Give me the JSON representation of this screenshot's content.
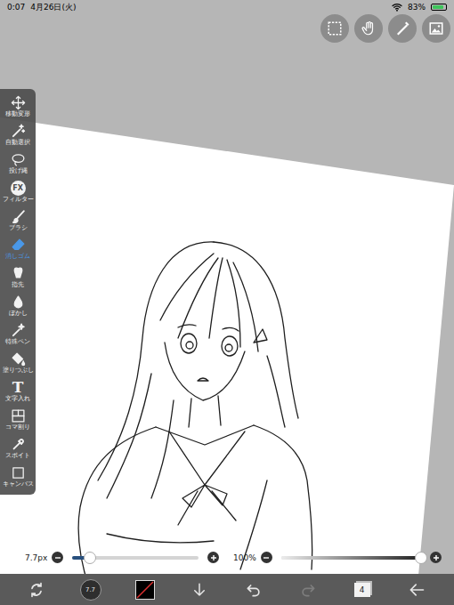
{
  "status_bar": {
    "time": "0:07",
    "date": "4月26日(火)",
    "battery": "83%",
    "battery_level": 0.83,
    "charging": true
  },
  "tools": [
    {
      "label": "移動変形",
      "selected": false
    },
    {
      "label": "自動選択",
      "selected": false
    },
    {
      "label": "投げ縄",
      "selected": false
    },
    {
      "label": "フィルター",
      "selected": false,
      "glyph": "FX"
    },
    {
      "label": "ブラシ",
      "selected": false
    },
    {
      "label": "消しゴム",
      "selected": true
    },
    {
      "label": "指先",
      "selected": false
    },
    {
      "label": "ぼかし",
      "selected": false
    },
    {
      "label": "特殊ペン",
      "selected": false
    },
    {
      "label": "塗りつぶし",
      "selected": false
    },
    {
      "label": "文字入れ",
      "selected": false,
      "glyph": "T"
    },
    {
      "label": "コマ割り",
      "selected": false
    },
    {
      "label": "スポイト",
      "selected": false
    },
    {
      "label": "キャンバス",
      "selected": false
    }
  ],
  "sliders": [
    {
      "kind": "size",
      "reading": "7.7px",
      "level": 0.14
    },
    {
      "kind": "opacity",
      "reading": "100%",
      "level": 1
    }
  ],
  "bottom_bar": {
    "brush_size": "7.7",
    "color": "#000000",
    "undo_disabled": false,
    "redo_disabled": true,
    "layer_count": "4"
  }
}
